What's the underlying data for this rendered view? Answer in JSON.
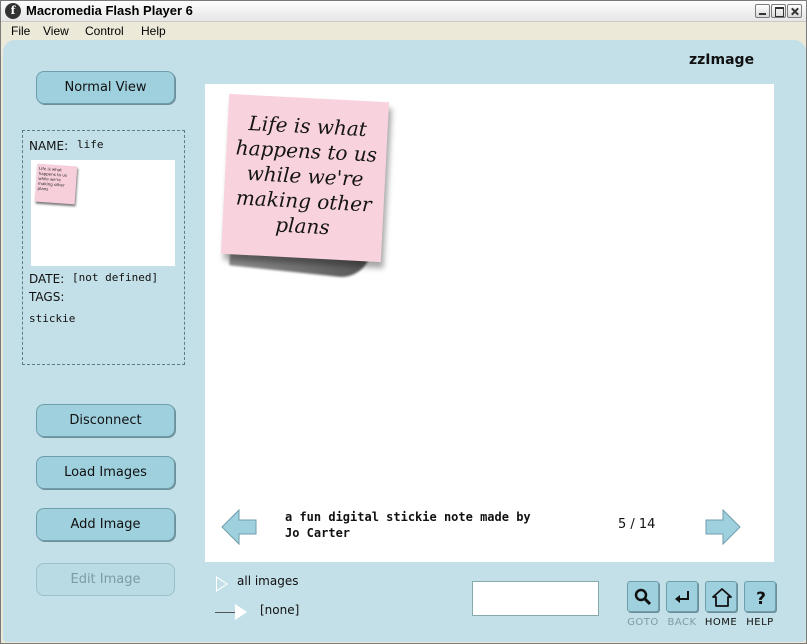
{
  "window": {
    "title": "Macromedia Flash Player 6"
  },
  "menu": [
    "File",
    "View",
    "Control",
    "Help"
  ],
  "app": {
    "brand": "zzImage"
  },
  "left_buttons": {
    "normal_view": "Normal View",
    "disconnect": "Disconnect",
    "load_images": "Load Images",
    "add_image": "Add Image",
    "edit_image": "Edit Image"
  },
  "info": {
    "name_label": "NAME:",
    "name_value": "life",
    "date_label": "DATE:",
    "date_value": "[not defined]",
    "tags_label": "TAGS:",
    "tags_value": "stickie"
  },
  "image": {
    "sticky_text": "Life is what happens to us while we're making other plans"
  },
  "viewer": {
    "caption": "a fun digital stickie note made by Jo Carter",
    "counter": "5 / 14"
  },
  "filters": {
    "collection": "all images",
    "tag": "[none]"
  },
  "search": {
    "value": ""
  },
  "nav": [
    {
      "label": "GOTO",
      "icon": "magnifier-icon"
    },
    {
      "label": "BACK",
      "icon": "back-arrow-icon"
    },
    {
      "label": "HOME",
      "icon": "home-icon"
    },
    {
      "label": "HELP",
      "icon": "question-icon"
    }
  ],
  "colors": {
    "stage_bg": "#c3dfe7",
    "button_bg": "#9fd0de",
    "sticky_pink": "#f8d3de",
    "nav_label_disabled": "#7e9aa2"
  }
}
